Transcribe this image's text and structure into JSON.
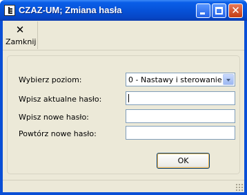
{
  "window": {
    "title": "CZAZ-UM; Zmiana hasła",
    "icon": "app-document-icon"
  },
  "titlebar_buttons": {
    "minimize_icon": "minimize-icon",
    "maximize_icon": "maximize-icon",
    "close_glyph": "✕"
  },
  "toolbar": {
    "close_label": "Zamknij",
    "close_icon_glyph": "✕"
  },
  "form": {
    "level_label": "Wybierz poziom:",
    "level_value": "0 - Nastawy i sterowanie",
    "current_password_label": "Wpisz aktualne hasło:",
    "current_password_value": "",
    "new_password_label": "Wpisz nowe hasło:",
    "new_password_value": "",
    "repeat_password_label": "Powtórz nowe hasło:",
    "repeat_password_value": "",
    "ok_label": "OK"
  },
  "colors": {
    "titlebar": "#0652d8",
    "client_background": "#ece9d8",
    "input_border": "#7f9db9"
  }
}
